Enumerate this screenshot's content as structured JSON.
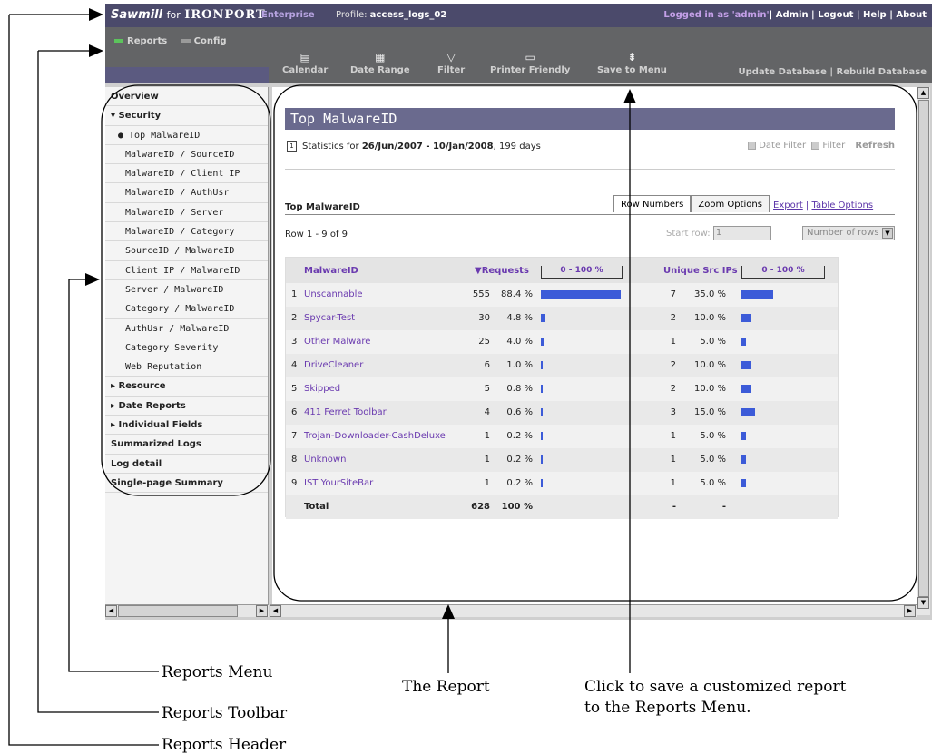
{
  "header": {
    "brand_app": "Sawmill",
    "brand_for": "for",
    "brand_vendor": "IRONPORT",
    "edition": "Enterprise",
    "profile_label": "Profile:",
    "profile_value": "access_logs_02",
    "logged_in": "Logged in as 'admin'",
    "links": "| Admin | Logout | Help | About"
  },
  "toolbar": {
    "tab_reports": "Reports",
    "tab_config": "Config",
    "buttons": [
      "Calendar",
      "Date Range",
      "Filter",
      "Printer Friendly",
      "Save to Menu"
    ],
    "right": "Update Database | Rebuild Database"
  },
  "sidebar": {
    "items": [
      {
        "label": "Overview",
        "kind": "bold"
      },
      {
        "label": "▾ Security",
        "kind": "bold"
      },
      {
        "label": "● Top MalwareID",
        "kind": "sub-sel"
      },
      {
        "label": "MalwareID / SourceID",
        "kind": "sub"
      },
      {
        "label": "MalwareID / Client IP",
        "kind": "sub"
      },
      {
        "label": "MalwareID / AuthUsr",
        "kind": "sub"
      },
      {
        "label": "MalwareID / Server",
        "kind": "sub"
      },
      {
        "label": "MalwareID / Category",
        "kind": "sub"
      },
      {
        "label": "SourceID / MalwareID",
        "kind": "sub"
      },
      {
        "label": "Client IP / MalwareID",
        "kind": "sub"
      },
      {
        "label": "Server / MalwareID",
        "kind": "sub"
      },
      {
        "label": "Category / MalwareID",
        "kind": "sub"
      },
      {
        "label": "AuthUsr / MalwareID",
        "kind": "sub"
      },
      {
        "label": "Category Severity",
        "kind": "sub"
      },
      {
        "label": "Web Reputation",
        "kind": "sub"
      },
      {
        "label": "▸ Resource",
        "kind": "bold"
      },
      {
        "label": "▸ Date Reports",
        "kind": "bold"
      },
      {
        "label": "▸ Individual Fields",
        "kind": "bold"
      },
      {
        "label": "Summarized Logs",
        "kind": "bold"
      },
      {
        "label": "Log detail",
        "kind": "bold"
      },
      {
        "label": "Single-page Summary",
        "kind": "bold"
      }
    ]
  },
  "report": {
    "title": "Top MalwareID",
    "stats_prefix": "Statistics for ",
    "stats_range": "26/Jun/2007 - 10/Jan/2008",
    "stats_suffix": ", 199 days",
    "date_filter": "Date Filter",
    "filter": "Filter",
    "refresh": "Refresh",
    "section_label": "Top MalwareID",
    "tab_row_numbers": "Row Numbers",
    "tab_zoom": "Zoom Options",
    "link_export": "Export",
    "link_sep": "|",
    "link_table_options": "Table Options",
    "row_info": "Row 1 - 9 of 9",
    "start_row_label": "Start row:",
    "start_row_value": "1",
    "number_of_rows": "Number of rows",
    "table": {
      "col_malware": "MalwareID",
      "col_requests": "▼Requests",
      "col_scale1": "0 - 100 %",
      "col_unique": "Unique Src IPs",
      "col_scale2": "0 - 100 %",
      "rows": [
        {
          "n": "1",
          "name": "Unscannable",
          "req": "555",
          "pct": "88.4 %",
          "req_frac": 0.884,
          "ips": "7",
          "ippct": "35.0 %",
          "ip_frac": 0.35
        },
        {
          "n": "2",
          "name": "Spycar-Test",
          "req": "30",
          "pct": "4.8 %",
          "req_frac": 0.048,
          "ips": "2",
          "ippct": "10.0 %",
          "ip_frac": 0.1
        },
        {
          "n": "3",
          "name": "Other Malware",
          "req": "25",
          "pct": "4.0 %",
          "req_frac": 0.04,
          "ips": "1",
          "ippct": "5.0 %",
          "ip_frac": 0.05
        },
        {
          "n": "4",
          "name": "DriveCleaner",
          "req": "6",
          "pct": "1.0 %",
          "req_frac": 0.01,
          "ips": "2",
          "ippct": "10.0 %",
          "ip_frac": 0.1
        },
        {
          "n": "5",
          "name": "Skipped",
          "req": "5",
          "pct": "0.8 %",
          "req_frac": 0.008,
          "ips": "2",
          "ippct": "10.0 %",
          "ip_frac": 0.1
        },
        {
          "n": "6",
          "name": "411 Ferret Toolbar",
          "req": "4",
          "pct": "0.6 %",
          "req_frac": 0.006,
          "ips": "3",
          "ippct": "15.0 %",
          "ip_frac": 0.15
        },
        {
          "n": "7",
          "name": "Trojan-Downloader-CashDeluxe",
          "req": "1",
          "pct": "0.2 %",
          "req_frac": 0.002,
          "ips": "1",
          "ippct": "5.0 %",
          "ip_frac": 0.05
        },
        {
          "n": "8",
          "name": "Unknown",
          "req": "1",
          "pct": "0.2 %",
          "req_frac": 0.002,
          "ips": "1",
          "ippct": "5.0 %",
          "ip_frac": 0.05
        },
        {
          "n": "9",
          "name": "IST YourSiteBar",
          "req": "1",
          "pct": "0.2 %",
          "req_frac": 0.002,
          "ips": "1",
          "ippct": "5.0 %",
          "ip_frac": 0.05
        }
      ],
      "total_label": "Total",
      "total_req": "628",
      "total_pct": "100 %",
      "total_ips": "-",
      "total_ippct": "-"
    }
  },
  "annotations": {
    "reports_menu": "Reports Menu",
    "the_report": "The Report",
    "save_note_line1": "Click to save a customized report",
    "save_note_line2": "to the Reports Menu.",
    "reports_toolbar": "Reports Toolbar",
    "reports_header": "Reports Header"
  },
  "colors": {
    "header_bg": "#4b4a6b",
    "toolbar_bg": "#636466",
    "title_bar": "#6a6a8e",
    "link_purple": "#6a3aaf",
    "bar_blue": "#3c5bd8"
  }
}
